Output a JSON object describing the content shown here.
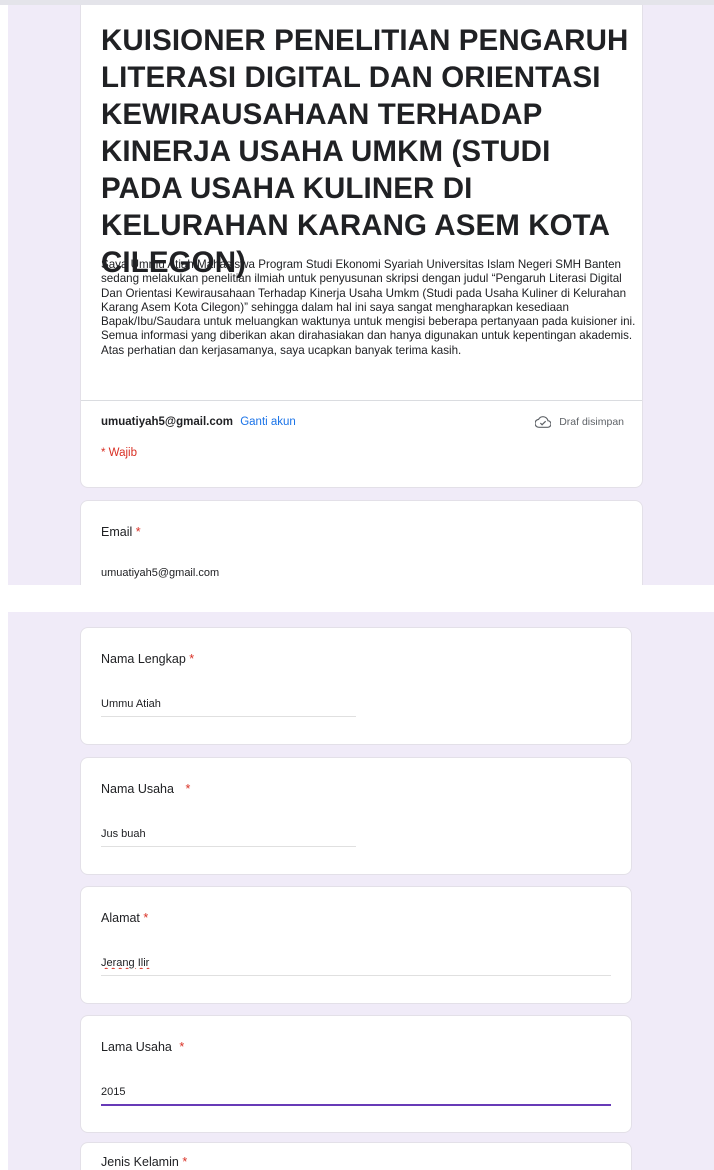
{
  "form": {
    "title": "KUISIONER PENELITIAN PENGARUH LITERASI DIGITAL DAN ORIENTASI KEWIRAUSAHAAN TERHADAP KINERJA USAHA UMKM (STUDI PADA USAHA KULINER DI KELURAHAN KARANG ASEM KOTA CILEGON)",
    "description": "Saya Ummu Atiah Mahasiswa Program Studi Ekonomi Syariah Universitas Islam Negeri SMH Banten sedang melakukan penelitian ilmiah untuk penyusunan skripsi dengan judul “Pengaruh Literasi Digital Dan Orientasi Kewirausahaan Terhadap Kinerja Usaha Umkm (Studi pada Usaha Kuliner di Kelurahan Karang Asem Kota Cilegon)” sehingga dalam hal ini saya sangat mengharapkan kesediaan Bapak/Ibu/Saudara untuk meluangkan waktunya untuk mengisi beberapa pertanyaan pada kuisioner ini. Semua informasi yang diberikan akan dirahasiakan dan hanya digunakan untuk kepentingan akademis.\nAtas perhatian dan kerjasamanya, saya ucapkan banyak terima kasih.",
    "account_email": "umuatiyah5@gmail.com",
    "switch_account": "Ganti akun",
    "draft_status": "Draf disimpan",
    "draft_icon": "cloud-done-icon",
    "required_note": "* Wajib"
  },
  "questions": {
    "email": {
      "label": "Email",
      "required": "*",
      "value": "umuatiyah5@gmail.com"
    },
    "nama_lengkap": {
      "label": "Nama Lengkap",
      "required": "*",
      "value": "Ummu Atiah"
    },
    "nama_usaha": {
      "label": "Nama Usaha",
      "required": "*",
      "value": "Jus buah"
    },
    "alamat": {
      "label": "Alamat",
      "required": "*",
      "value": "Jerang Ilir"
    },
    "lama_usaha": {
      "label": "Lama Usaha",
      "required": "*",
      "value": "2015"
    },
    "jenis_kelamin": {
      "label": "Jenis Kelamin",
      "required": "*"
    }
  },
  "colors": {
    "background": "#f0ebf8",
    "accent": "#673ab7",
    "link": "#1a73e8",
    "required": "#d93025"
  }
}
